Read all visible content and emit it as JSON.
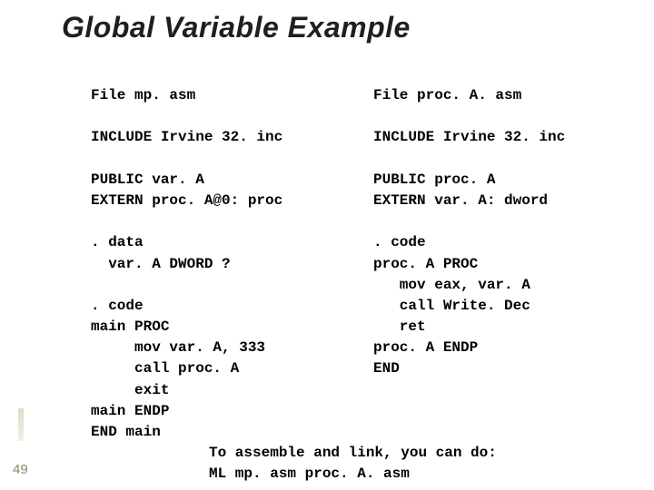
{
  "title": "Global Variable Example",
  "left": {
    "file": "File mp. asm",
    "include": "INCLUDE Irvine 32. inc",
    "decl1": "PUBLIC var. A",
    "decl2": "EXTERN proc. A@0: proc",
    "data1": ". data",
    "data2": "  var. A DWORD ?",
    "code0": ". code",
    "code1": "main PROC",
    "code2": "     mov var. A, 333",
    "code3": "     call proc. A",
    "code4": "     exit",
    "code5": "main ENDP",
    "code6": "END main"
  },
  "right": {
    "file": "File proc. A. asm",
    "include": "INCLUDE Irvine 32. inc",
    "decl1": "PUBLIC proc. A",
    "decl2": "EXTERN var. A: dword",
    "code0": ". code",
    "code1": "proc. A PROC",
    "code2": "   mov eax, var. A",
    "code3": "   call Write. Dec",
    "code4": "   ret",
    "code5": "proc. A ENDP",
    "code6": "END"
  },
  "footer": {
    "line1": "To assemble and link, you can do:",
    "line2": "ML mp. asm proc. A. asm"
  },
  "slide_number": "49"
}
